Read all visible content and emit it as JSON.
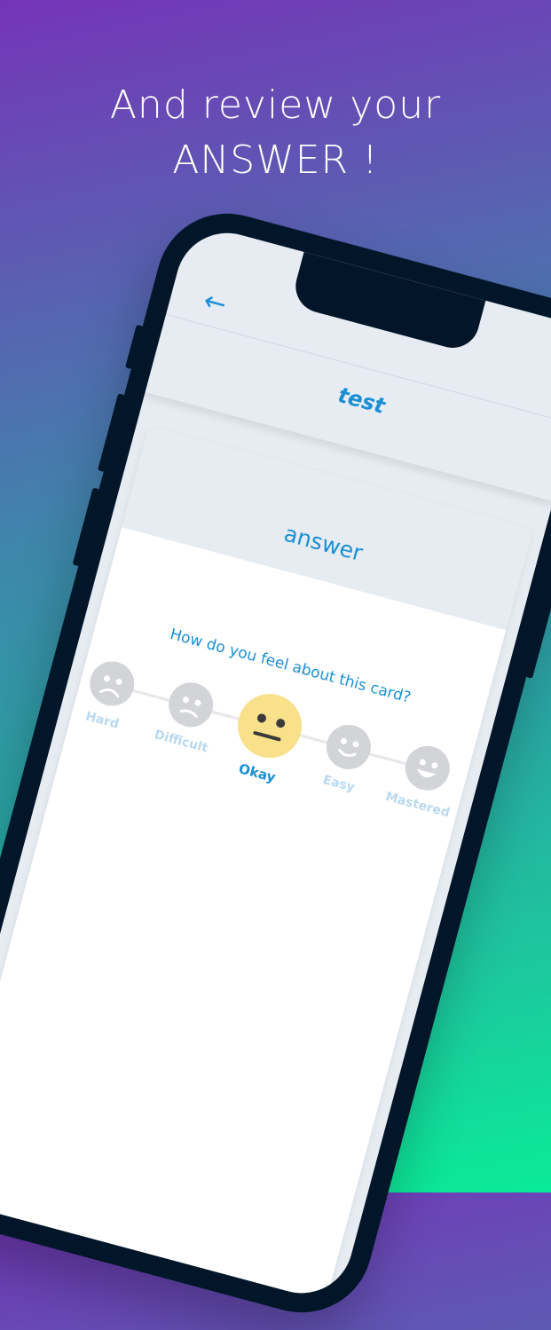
{
  "headline": {
    "line1": "And review your",
    "line2": "ANSWER !"
  },
  "screen": {
    "back_icon": "arrow-left-icon",
    "title": "test",
    "answer": "answer",
    "question": "How do you feel about this card?",
    "ratings": [
      {
        "label": "Hard",
        "icon": "sad-face-icon",
        "selected": false
      },
      {
        "label": "Difficult",
        "icon": "frown-face-icon",
        "selected": false
      },
      {
        "label": "Okay",
        "icon": "neutral-face-icon",
        "selected": true
      },
      {
        "label": "Easy",
        "icon": "smile-face-icon",
        "selected": false
      },
      {
        "label": "Mastered",
        "icon": "happy-face-icon",
        "selected": false
      }
    ]
  },
  "colors": {
    "accent": "#1a8fd4",
    "selected_face": "#f9e08a",
    "inactive_face": "#d2d4d7",
    "inactive_label": "#b9d9f0",
    "phone_frame": "#011628"
  }
}
